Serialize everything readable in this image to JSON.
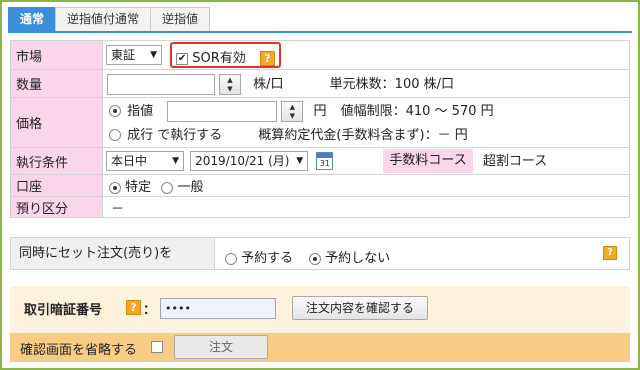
{
  "tabs": [
    "通常",
    "逆指値付通常",
    "逆指値"
  ],
  "form": {
    "market": {
      "label": "市場",
      "value": "東証",
      "sor_label": "SOR有効",
      "help": "?"
    },
    "quantity": {
      "label": "数量",
      "unit": "株/口",
      "unit_info": "単元株数：100 株/口"
    },
    "price": {
      "label": "価格",
      "limit_label": "指値",
      "currency": "円",
      "price_limit": "値幅制限：410 ～ 570 円",
      "market_label": "成行 で執行する",
      "estimate": "概算約定代金(手数料含まず)：－ 円"
    },
    "condition": {
      "label": "執行条件",
      "validity": "本日中",
      "date": "2019/10/21 (月)",
      "calendar_day": "31",
      "fee_label": "手数料コース",
      "fee_value": "超割コース"
    },
    "account": {
      "label": "口座",
      "option1": "特定",
      "option2": "一般"
    },
    "deposit": {
      "label": "預り区分",
      "value": "－"
    }
  },
  "set_order": {
    "label": "同時にセット注文(売り)を",
    "option_yes": "予約する",
    "option_no": "予約しない",
    "help": "?"
  },
  "confirm": {
    "pin_label": "取引暗証番号",
    "help": "?",
    "colon": "：",
    "pin_value": "••••",
    "confirm_button": "注文内容を確認する",
    "skip_label": "確認画面を省略する",
    "order_button": "注文"
  }
}
